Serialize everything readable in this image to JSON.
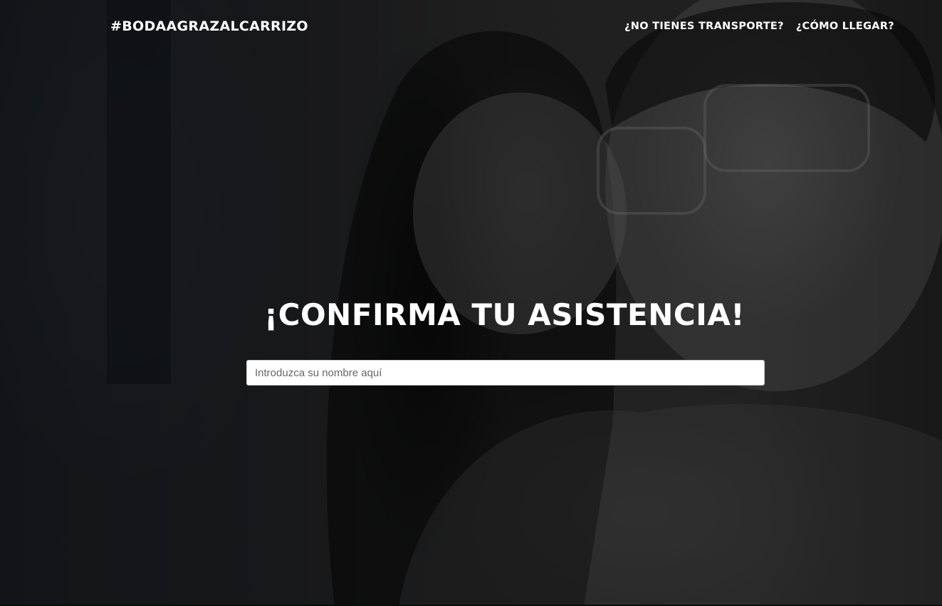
{
  "header": {
    "brand": "#BODAAGRAZALCARRIZO",
    "nav": [
      {
        "label": "¿NO TIENES TRANSPORTE?"
      },
      {
        "label": "¿CÓMO LLEGAR?"
      }
    ]
  },
  "main": {
    "heading": "¡CONFIRMA TU ASISTENCIA!",
    "name_input": {
      "placeholder": "Introduzca su nombre aquí",
      "value": ""
    }
  },
  "background": {
    "image": "couple-photo",
    "overlay_color": "#000000"
  }
}
